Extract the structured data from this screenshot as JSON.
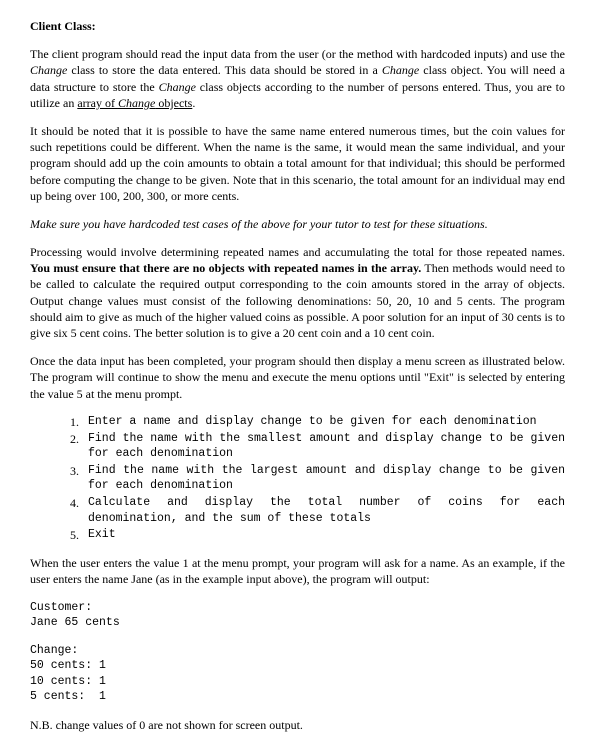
{
  "heading": "Client Class:",
  "para1_a": "The client program should read the ",
  "para1_b": "input data from the user (or the method with hardcoded inputs) and use the ",
  "para1_c": "Change",
  "para1_d": " class to store the data entered.",
  "para1_e": " This data should be stored in a ",
  "para1_f": "Change",
  "para1_g": " class object. You will need a data structure to store the ",
  "para1_h": "Change",
  "para1_i": " class objects according to the number of persons entered. Thus, you are to utilize an ",
  "para1_j": "array of ",
  "para1_j2": "Change",
  "para1_j3": " objects",
  "para1_k": ".",
  "para2_a": "It should be noted that it is possible to have the same name entered numerous times, ",
  "para2_b": "but the coin values for such repetitions could be different. When the name is the same, it would mean the same individual, and your program should add up the coin amounts to obtain a total amount for that individual;",
  "para2_c": " this should be performed ",
  "para2_d": "before computing the change to be given. Note that in this scenario, the total amount for an individual may end up being over 100, 200, 300, or more cents.",
  "para3": "Make sure you have hardcoded test cases of the above for your tutor to test for these situations.",
  "para4_a": "Processing would involve determining repeated names and accumulating the total for those repeated names. ",
  "para4_b": "You must ensure that there are no objects with repeated names in the array.",
  "para4_c": " Then methods would need to be called to calculate the required output corresponding to the coin amounts stored in the array of objects.",
  "para4_d": " Output change values must consist of the following denominations: 50, 20, 10 and 5 cents. The program should aim to give as much of the higher valued coins as possible. A poor solution for an input of 30 cents is to give six 5 cent coins. The better solution is to give a 20 cent coin and a 10 cent coin.",
  "para5_a": "Once the data input has been completed, your program should then ",
  "para5_b": "display",
  "para5_c": " a menu screen as illustrated below. The program will continue to show the menu and execute the menu options until \"Exit\" is selected by entering the value 5 at the menu prompt.",
  "menu": [
    {
      "num": "1.",
      "text": "Enter a name and display change to be given for each denomination"
    },
    {
      "num": "2.",
      "text": "Find the name with the smallest amount and display change to be given for each denomination"
    },
    {
      "num": "3.",
      "text": "Find the name with the largest amount and display change to be given for each denomination"
    },
    {
      "num": "4.",
      "text": "Calculate and display the total number of coins for each denomination, and the sum of these totals"
    },
    {
      "num": "5.",
      "text": "Exit"
    }
  ],
  "para6": "When the user enters the value 1 at the menu prompt, your program will ask for a name. As an example, if the user enters the name Jane (as in the example input above), the program will output:",
  "output1": "Customer:\nJane 65 cents",
  "output2": "Change:\n50 cents: 1\n10 cents: 1\n5 cents:  1",
  "para7": "N.B. change values of 0 are not shown for screen output."
}
